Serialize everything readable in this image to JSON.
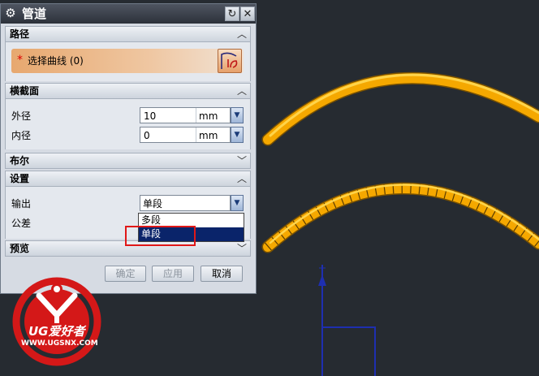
{
  "dialog": {
    "title": "管道",
    "sections": {
      "path": "路径",
      "cross_section": "横截面",
      "boolean": "布尔",
      "settings": "设置",
      "preview": "预览"
    },
    "select_curve": {
      "required_mark": "*",
      "label": "选择曲线 (0)"
    },
    "outer_diameter": {
      "label": "外径",
      "value": "10",
      "unit": "mm"
    },
    "inner_diameter": {
      "label": "内径",
      "value": "0",
      "unit": "mm"
    },
    "output": {
      "label": "输出",
      "value": "单段",
      "options": [
        "多段",
        "单段"
      ],
      "highlighted": "单段"
    },
    "tolerance": {
      "label": "公差"
    },
    "buttons": {
      "ok": "确定",
      "apply": "应用",
      "cancel": "取消"
    }
  },
  "watermark": {
    "brand": "UG爱好者",
    "url": "WWW.UGSNX.COM"
  },
  "colors": {
    "pipe": "#f5a800",
    "highlight_border": "#e01818",
    "selection": "#0a246a",
    "axis": "#1e2fb0"
  }
}
